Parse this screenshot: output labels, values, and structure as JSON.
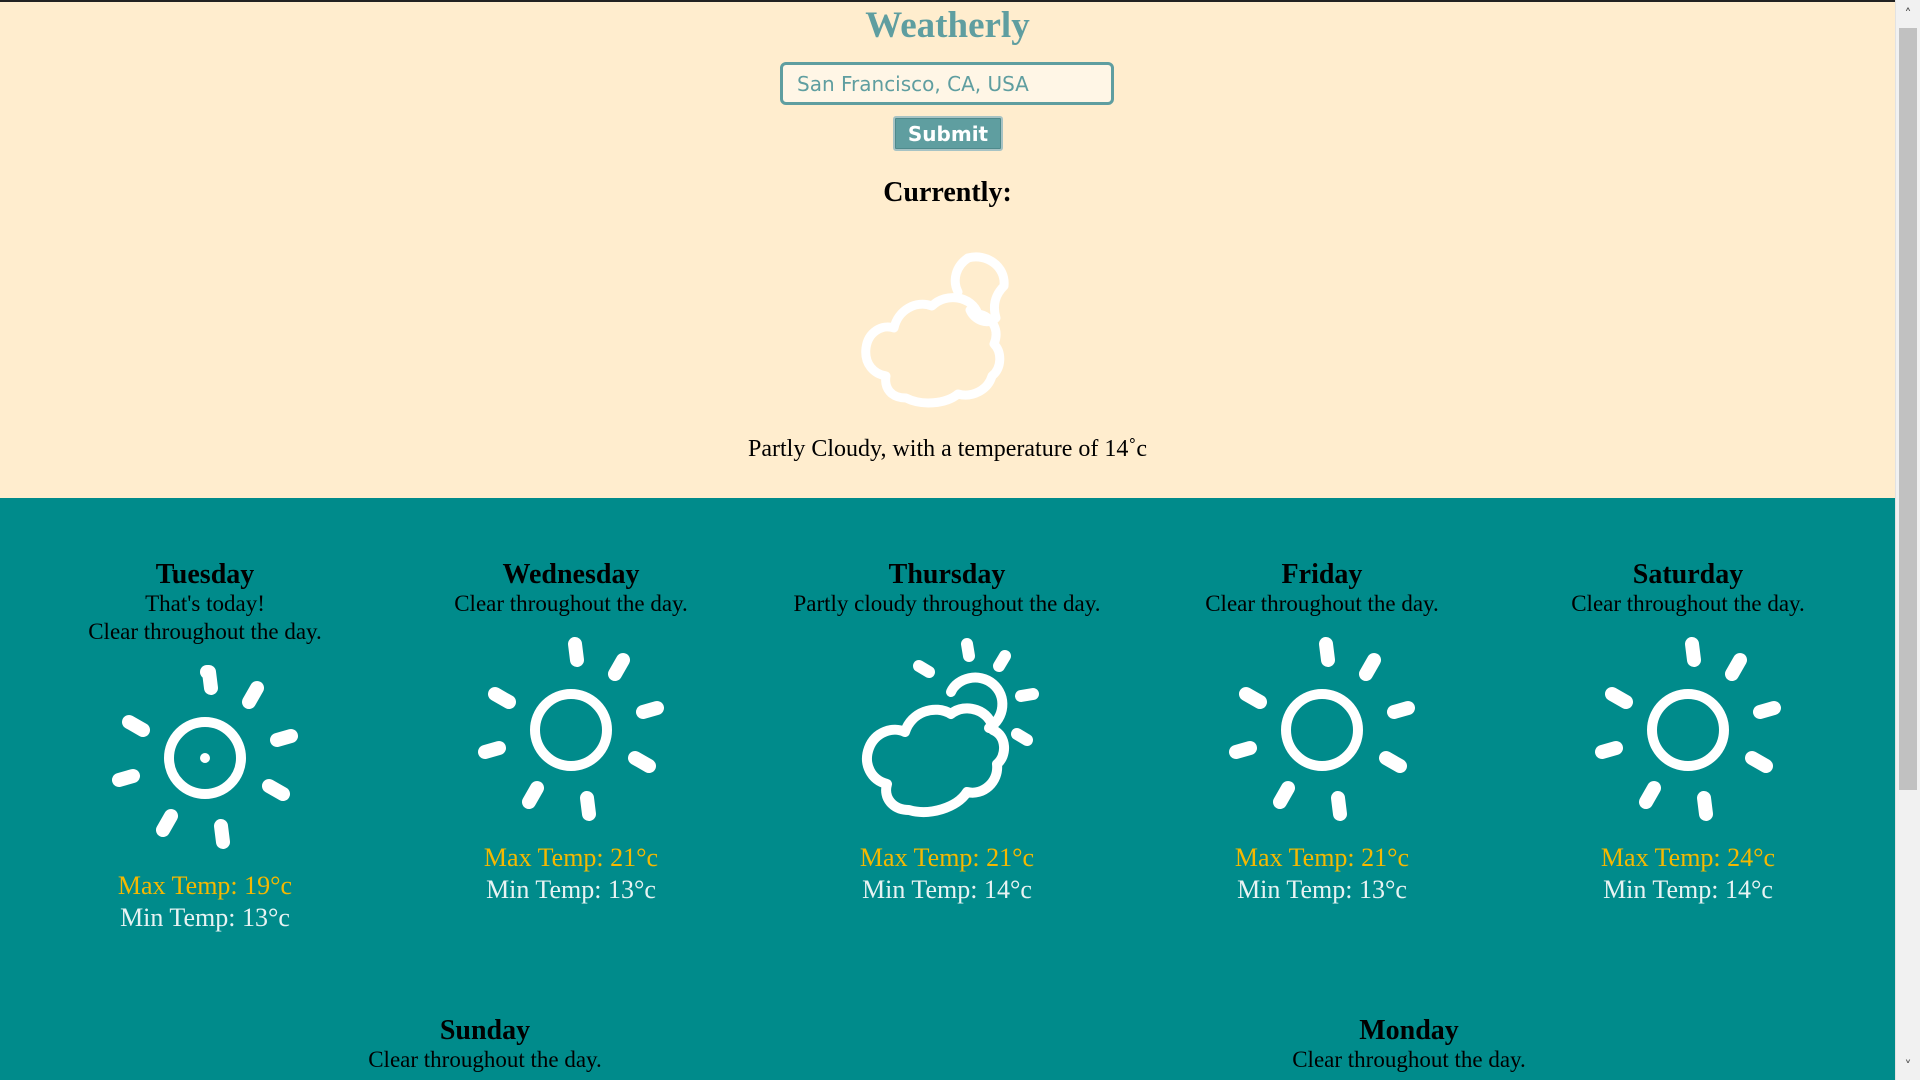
{
  "app": {
    "title": "Weatherly"
  },
  "search": {
    "value": "San Francisco, CA, USA",
    "placeholder": "San Francisco, CA, USA",
    "submit_label": "Submit"
  },
  "current": {
    "heading": "Currently:",
    "icon": "partly-cloudy-night-icon",
    "summary": "Partly Cloudy, with a temperature of 14˚c"
  },
  "forecast": [
    {
      "day": "Tuesday",
      "note": "That's today!",
      "summary": "Clear throughout the day.",
      "icon": "sun-icon",
      "max": "Max Temp: 19°c",
      "min": "Min Temp: 13°c"
    },
    {
      "day": "Wednesday",
      "note": "",
      "summary": "Clear throughout the day.",
      "icon": "sun-icon",
      "max": "Max Temp: 21°c",
      "min": "Min Temp: 13°c"
    },
    {
      "day": "Thursday",
      "note": "",
      "summary": "Partly cloudy throughout the day.",
      "icon": "partly-cloudy-day-icon",
      "max": "Max Temp: 21°c",
      "min": "Min Temp: 14°c"
    },
    {
      "day": "Friday",
      "note": "",
      "summary": "Clear throughout the day.",
      "icon": "sun-icon",
      "max": "Max Temp: 21°c",
      "min": "Min Temp: 13°c"
    },
    {
      "day": "Saturday",
      "note": "",
      "summary": "Clear throughout the day.",
      "icon": "sun-icon",
      "max": "Max Temp: 24°c",
      "min": "Min Temp: 14°c"
    },
    {
      "day": "Sunday",
      "note": "",
      "summary": "Clear throughout the day.",
      "icon": "sun-icon",
      "max": "",
      "min": ""
    },
    {
      "day": "Monday",
      "note": "",
      "summary": "Clear throughout the day.",
      "icon": "sun-icon",
      "max": "",
      "min": ""
    }
  ],
  "colors": {
    "top_background": "#ffedce",
    "bottom_background": "#008b8b",
    "accent": "#5f9ea0",
    "max_temp": "#f5b800",
    "min_temp": "#e8f3f3"
  }
}
